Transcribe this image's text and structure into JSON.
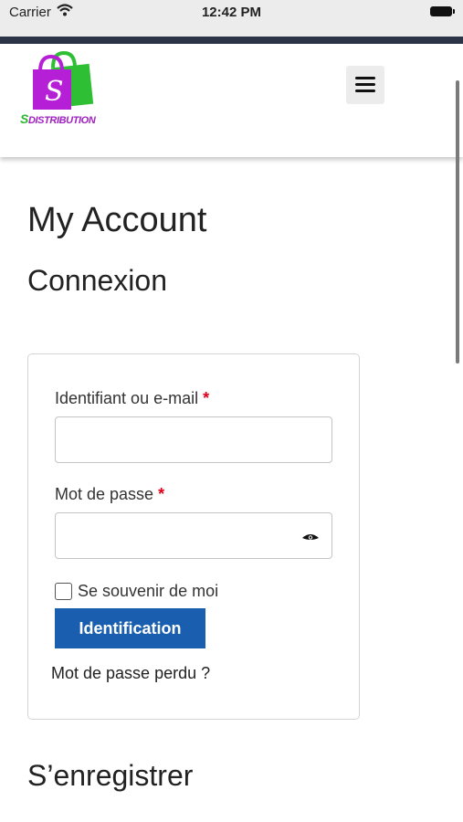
{
  "status_bar": {
    "carrier": "Carrier",
    "time": "12:42 PM",
    "wifi_icon": "wifi-icon",
    "battery_icon": "battery-icon"
  },
  "header": {
    "logo_text_first": "S",
    "logo_text_rest": "DISTRIBUTION",
    "logo_bag_letter": "S",
    "menu_icon": "hamburger-icon",
    "colors": {
      "bag_purple": "#b51fd6",
      "bag_green": "#2fbf35",
      "logo_text": "#a020c0"
    }
  },
  "main": {
    "page_title": "My Account",
    "login_section_title": "Connexion",
    "register_section_title": "S’enregistrer"
  },
  "login_form": {
    "username_label": "Identifiant ou e-mail",
    "password_label": "Mot de passe",
    "required_marker": "*",
    "username_value": "",
    "password_value": "",
    "show_password_icon": "eye-icon",
    "remember_label": "Se souvenir de moi",
    "remember_checked": false,
    "submit_label": "Identification",
    "lost_password_link": "Mot de passe perdu ?"
  },
  "colors": {
    "accent_button": "#1a5eb0",
    "required": "#e2001a",
    "status_strip": "#2c3447"
  }
}
